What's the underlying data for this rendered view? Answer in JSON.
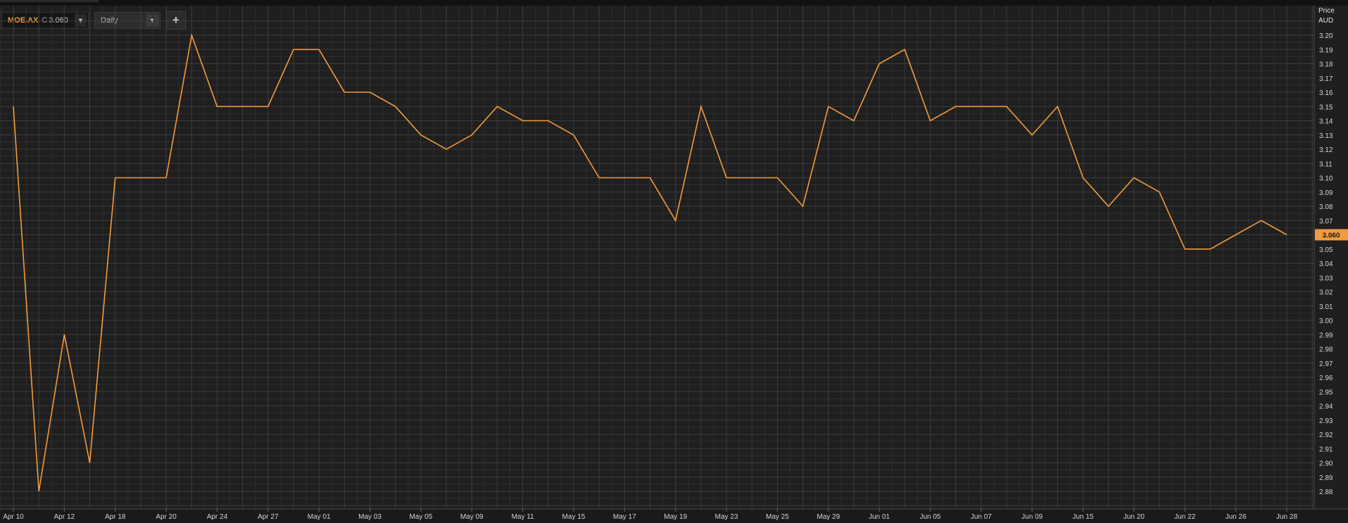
{
  "header": {
    "instrument": "MOE.AX",
    "close_prefix": "C",
    "close_value": "3.060",
    "interval": "Daily",
    "dropdown_glyph": "▼",
    "add_glyph": "+"
  },
  "axis": {
    "title_line1": "Price",
    "title_line2": "AUD"
  },
  "colors": {
    "series": "#f39a3c",
    "background": "#1f1f1f",
    "grid": "#3b3b3b"
  },
  "chart_data": {
    "type": "line",
    "ylim": [
      2.87,
      3.21
    ],
    "grid": true,
    "y_ticks": [
      "3.20",
      "3.19",
      "3.18",
      "3.17",
      "3.16",
      "3.15",
      "3.14",
      "3.13",
      "3.12",
      "3.11",
      "3.10",
      "3.09",
      "3.08",
      "3.07",
      "3.06",
      "3.05",
      "3.04",
      "3.03",
      "3.02",
      "3.01",
      "3.00",
      "2.99",
      "2.98",
      "2.97",
      "2.96",
      "2.95",
      "2.94",
      "2.93",
      "2.92",
      "2.91",
      "2.90",
      "2.89",
      "2.88"
    ],
    "x_tick_labels": [
      {
        "label": "Apr 10",
        "i": 0
      },
      {
        "label": "Apr 12",
        "i": 2
      },
      {
        "label": "Apr 18",
        "i": 4
      },
      {
        "label": "Apr 20",
        "i": 6
      },
      {
        "label": "Apr 24",
        "i": 8
      },
      {
        "label": "Apr 27",
        "i": 10
      },
      {
        "label": "May 01",
        "i": 12
      },
      {
        "label": "May 03",
        "i": 14
      },
      {
        "label": "May 05",
        "i": 16
      },
      {
        "label": "May 09",
        "i": 18
      },
      {
        "label": "May 11",
        "i": 20
      },
      {
        "label": "May 15",
        "i": 22
      },
      {
        "label": "May 17",
        "i": 24
      },
      {
        "label": "May 19",
        "i": 26
      },
      {
        "label": "May 23",
        "i": 28
      },
      {
        "label": "May 25",
        "i": 30
      },
      {
        "label": "May 29",
        "i": 32
      },
      {
        "label": "Jun 01",
        "i": 34
      },
      {
        "label": "Jun 05",
        "i": 36
      },
      {
        "label": "Jun 07",
        "i": 38
      },
      {
        "label": "Jun 09",
        "i": 40
      },
      {
        "label": "Jun 15",
        "i": 42
      },
      {
        "label": "Jun 20",
        "i": 44
      },
      {
        "label": "Jun 22",
        "i": 46
      },
      {
        "label": "Jun 26",
        "i": 48
      },
      {
        "label": "Jun 28",
        "i": 50
      }
    ],
    "last_price_label": "3.060",
    "series": [
      {
        "values": [
          3.15,
          2.88,
          2.99,
          2.9,
          3.1,
          3.1,
          3.1,
          3.2,
          3.15,
          3.15,
          3.15,
          3.19,
          3.19,
          3.16,
          3.16,
          3.15,
          3.13,
          3.12,
          3.13,
          3.15,
          3.14,
          3.14,
          3.13,
          3.1,
          3.1,
          3.1,
          3.07,
          3.15,
          3.1,
          3.1,
          3.1,
          3.08,
          3.15,
          3.14,
          3.18,
          3.19,
          3.14,
          3.15,
          3.15,
          3.15,
          3.13,
          3.15,
          3.1,
          3.08,
          3.1,
          3.09,
          3.05,
          3.05,
          3.06,
          3.07,
          3.06
        ]
      }
    ]
  }
}
